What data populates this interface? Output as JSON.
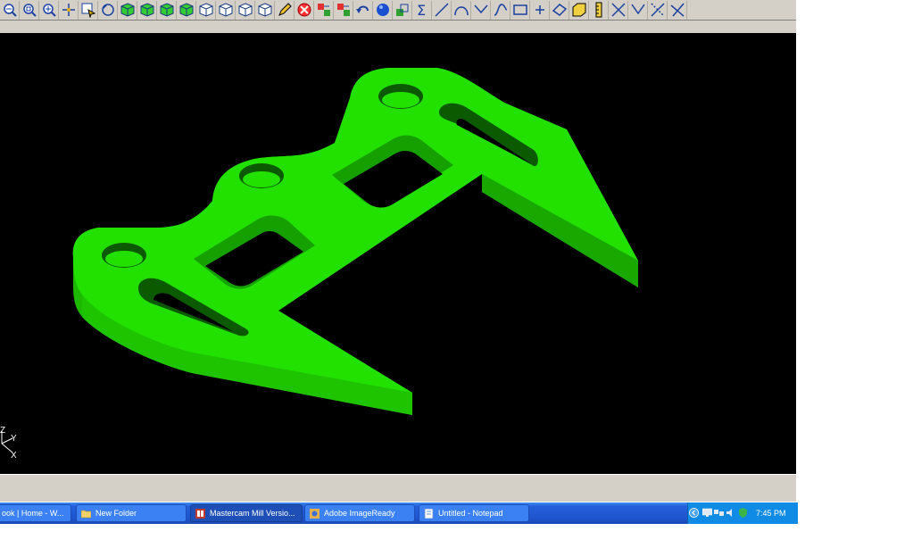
{
  "window": {
    "app": "Mastercam Mill",
    "toolbar_icons": [
      "zoom-out-icon",
      "zoom-window-icon",
      "zoom-in-icon",
      "pan-icon",
      "select-icon",
      "unzoom-icon",
      "view-top-icon",
      "view-front-icon",
      "view-side-icon",
      "view-iso-icon",
      "cube-view-1-icon",
      "cube-view-2-icon",
      "cube-view-3-icon",
      "cube-view-4-icon",
      "pencil-icon",
      "delete-icon",
      "transform-icon",
      "multi-select-icon",
      "undo-icon",
      "sphere-icon",
      "level-icon",
      "sigma-icon",
      "line-icon",
      "arc-icon",
      "fillet-icon",
      "spline-icon",
      "rectangle-icon",
      "point-icon",
      "plane-icon",
      "solid-icon",
      "ruler-icon",
      "trim-x-icon",
      "trim-v-icon",
      "trim-dotted-icon",
      "trim-cross-icon"
    ],
    "colors": {
      "toolbar_bg": "#d4d0c8",
      "viewport_bg": "#000000",
      "part_green": "#22e000",
      "taskbar_blue": "#2460d9",
      "tray_blue": "#0f8be6"
    }
  },
  "viewport": {
    "axis_labels": {
      "z": "Z",
      "y": "Y",
      "x": "X"
    }
  },
  "taskbar": {
    "items": [
      {
        "label": "ook | Home - W...",
        "icon": "browser-icon",
        "active": false
      },
      {
        "label": "New Folder",
        "icon": "folder-icon",
        "active": false
      },
      {
        "label": "Mastercam Mill Versio...",
        "icon": "mastercam-icon",
        "active": true
      },
      {
        "label": "Adobe ImageReady",
        "icon": "imageready-icon",
        "active": false
      },
      {
        "label": "Untitled - Notepad",
        "icon": "notepad-icon",
        "active": false
      }
    ],
    "tray_icons": [
      "show-hidden-icon",
      "display-icon",
      "network-icon",
      "volume-icon",
      "security-icon"
    ],
    "clock": "7:45 PM"
  }
}
